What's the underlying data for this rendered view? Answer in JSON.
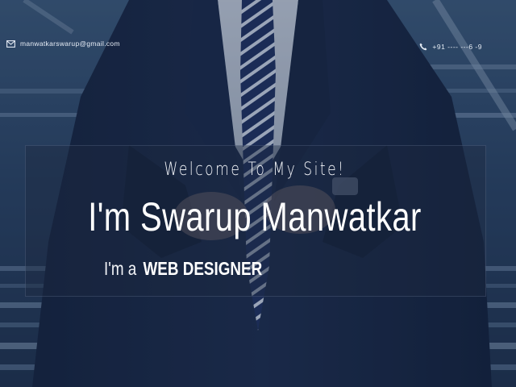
{
  "contact": {
    "email": "manwatkarswarup@gmail.com",
    "email_icon": "envelope-icon",
    "phone": "+91 ---- ---6 -9",
    "phone_icon": "phone-icon"
  },
  "hero": {
    "welcome": "Welcome To My Site!",
    "name": "I'm Swarup Manwatkar",
    "role_prefix": "I'm a",
    "role": "WEB DESIGNER"
  },
  "colors": {
    "overlay": "#1c2840",
    "text": "#ffffff",
    "background": "#0e1a2c"
  }
}
